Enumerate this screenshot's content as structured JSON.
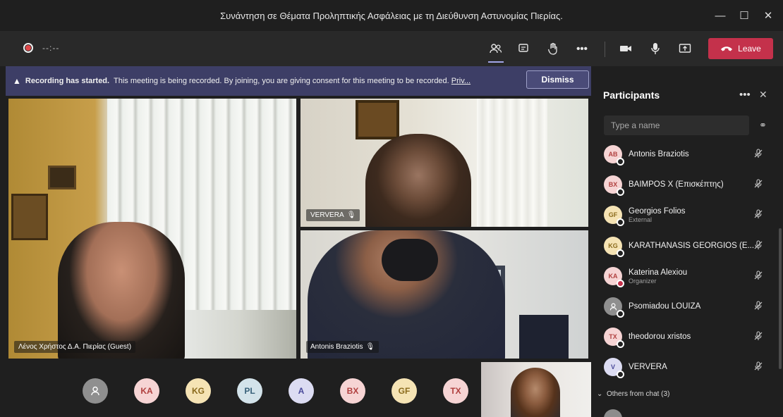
{
  "window": {
    "title": "Συνάντηση σε Θέματα Προληπτικής Ασφάλειας με τη Διεύθυνση Αστυνομίας Πιερίας.",
    "minimize_icon": "minimize-icon",
    "maximize_icon": "maximize-icon",
    "close_icon": "close-icon"
  },
  "toolbar": {
    "timer": "--:--",
    "leave_label": "Leave",
    "icons": [
      "participants-icon",
      "chat-icon",
      "raise-hand-icon",
      "more-icon",
      "camera-icon",
      "microphone-icon",
      "share-screen-icon"
    ]
  },
  "banner": {
    "bold": "Recording has started.",
    "text": "This meeting is being recorded. By joining, you are giving consent for this meeting to be recorded.",
    "link": "Priv...",
    "dismiss_label": "Dismiss"
  },
  "videos": [
    {
      "label": "Λένος Χρήστος Δ.Α. Πιερίας (Guest)"
    },
    {
      "label": "VERVERA"
    },
    {
      "label": "Antonis Braziotis"
    }
  ],
  "bottom_avatars": [
    {
      "initials": "",
      "color": "#8f8f8f",
      "text_color": "#ffffff"
    },
    {
      "initials": "KA",
      "color": "#f6d4d4",
      "text_color": "#b0403f"
    },
    {
      "initials": "KG",
      "color": "#f5e3b4",
      "text_color": "#8a6a1c"
    },
    {
      "initials": "PL",
      "color": "#d3e3ea",
      "text_color": "#39627a"
    },
    {
      "initials": "A",
      "color": "#dcdcf2",
      "text_color": "#4a4a9a"
    },
    {
      "initials": "BX",
      "color": "#f6d4d4",
      "text_color": "#b0403f"
    },
    {
      "initials": "GF",
      "color": "#f5e3b4",
      "text_color": "#8a6a1c"
    },
    {
      "initials": "TX",
      "color": "#f6d4d4",
      "text_color": "#b0403f"
    }
  ],
  "panel": {
    "title": "Participants",
    "search_placeholder": "Type a name",
    "others_label": "Others from chat (3)",
    "participants": [
      {
        "initials": "AB",
        "name": "Antonis Braziotis",
        "sub": "",
        "color": "#f6d4d4",
        "text_color": "#b0403f",
        "status": "away"
      },
      {
        "initials": "BX",
        "name": "BAIMPOS X (Επισκέπτης)",
        "sub": "",
        "color": "#f6d4d4",
        "text_color": "#b0403f",
        "status": "away"
      },
      {
        "initials": "GF",
        "name": "Georgios Folios",
        "sub": "External",
        "color": "#f5e3b4",
        "text_color": "#8a6a1c",
        "status": "away"
      },
      {
        "initials": "KG",
        "name": "KARATHANASIS GEORGIOS (E...",
        "sub": "",
        "color": "#f5e3b4",
        "text_color": "#8a6a1c",
        "status": "away"
      },
      {
        "initials": "KA",
        "name": "Katerina Alexiou",
        "sub": "Organizer",
        "color": "#f6d4d4",
        "text_color": "#b0403f",
        "status": "busy"
      },
      {
        "initials": "",
        "name": "Psomiadou LOUIZA",
        "sub": "",
        "color": "#8f8f8f",
        "text_color": "#ffffff",
        "status": "away"
      },
      {
        "initials": "TX",
        "name": "theodorou xristos",
        "sub": "",
        "color": "#f6d4d4",
        "text_color": "#b0403f",
        "status": "away"
      },
      {
        "initials": "V",
        "name": "VERVERA",
        "sub": "",
        "color": "#dcdcf2",
        "text_color": "#4a4a9a",
        "status": "away"
      }
    ]
  }
}
